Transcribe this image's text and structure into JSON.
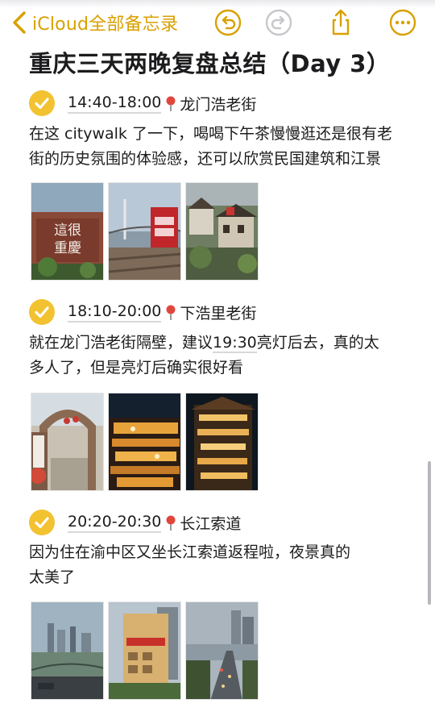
{
  "nav": {
    "back_label": "iCloud全部备忘录",
    "icons": [
      "chevron-left-icon",
      "undo-icon",
      "redo-icon",
      "share-icon",
      "more-icon"
    ]
  },
  "note": {
    "title": "重庆三天两晚复盘总结（Day 3）",
    "sections": [
      {
        "time": "14:40-18:00",
        "place": "龙门浩老街",
        "text_lines": [
          "在这 citywalk 了一下，喝喝下午茶慢慢逛还是很有老",
          "街的历史氛围的体验感，还可以欣赏民国建筑和江景"
        ],
        "photo_subjects": [
          "sign-wall-photo",
          "bridge-view-photo",
          "old-street-photo"
        ]
      },
      {
        "time": "18:10-20:00",
        "place": "下浩里老街",
        "text_lines": [
          "就在龙门浩老街隔壁，建议",
          "19:30",
          "亮灯后去，真的太",
          "多人了，但是亮灯后确实很好看"
        ],
        "photo_subjects": [
          "archway-photo",
          "night-lights-photo",
          "night-buildings-photo"
        ]
      },
      {
        "time": "20:20-20:30",
        "place": "长江索道",
        "text_lines": [
          "因为住在渝中区又坐长江索道返程啦，夜景真的",
          "太美了"
        ],
        "photo_subjects": [
          "river-skyline-photo",
          "cable-station-photo",
          "street-dusk-photo"
        ]
      }
    ]
  },
  "colors": {
    "accent": "#d9a000",
    "check_fill": "#f2c230",
    "pin_red": "#e0463c"
  }
}
